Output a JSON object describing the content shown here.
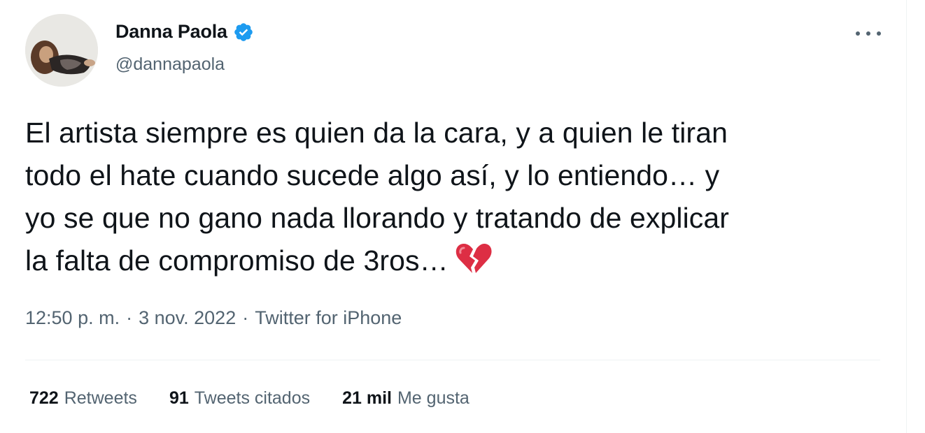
{
  "user": {
    "name": "Danna Paola",
    "handle": "@dannapaola",
    "verified_color": "#1d9bf0"
  },
  "tweet": {
    "lines": [
      "El artista siempre es quien da la cara, y a quien le tiran",
      "todo el hate cuando sucede algo así, y lo entiendo… y",
      "yo se que no gano nada llorando y tratando de explicar",
      "la falta de compromiso de 3ros…"
    ],
    "emoji": "broken-heart"
  },
  "meta": {
    "time": "12:50 p. m.",
    "separator": "·",
    "date": "3 nov. 2022",
    "source": "Twitter for iPhone"
  },
  "stats": {
    "retweets_count": "722",
    "retweets_label": "Retweets",
    "quotes_count": "91",
    "quotes_label": "Tweets citados",
    "likes_count": "21 mil",
    "likes_label": "Me gusta"
  },
  "icons": {
    "more": "more-options-icon",
    "verified": "verified-badge-icon",
    "emoji": "broken-heart-emoji"
  }
}
